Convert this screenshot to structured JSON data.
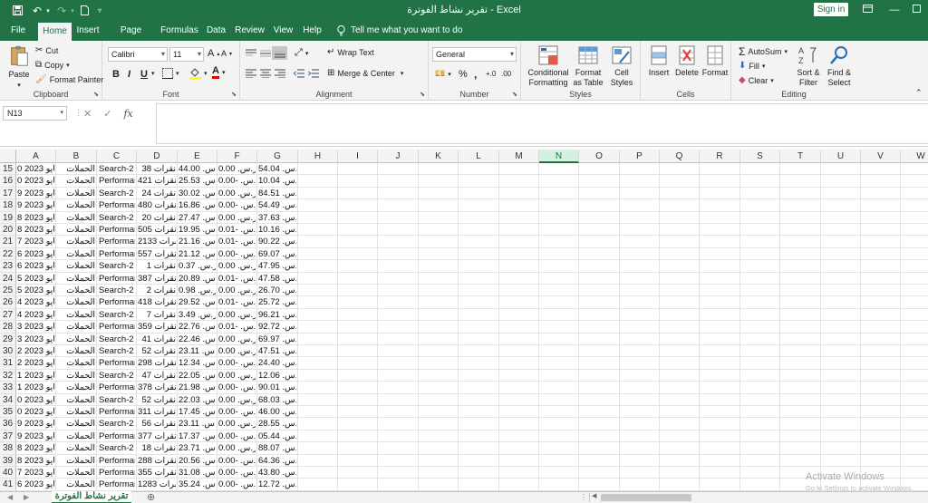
{
  "app": {
    "title": "تقرير نشاط الفوترة  -  Excel",
    "signin": "Sign in"
  },
  "tabs": [
    "File",
    "Home",
    "Insert",
    "Page Layout",
    "Formulas",
    "Data",
    "Review",
    "View",
    "Help"
  ],
  "tell_me": "Tell me what you want to do",
  "ribbon": {
    "clipboard": {
      "label": "Clipboard",
      "paste": "Paste",
      "cut": "Cut",
      "copy": "Copy",
      "format_painter": "Format Painter"
    },
    "font": {
      "label": "Font",
      "family": "Calibri",
      "size": "11",
      "bold": "B",
      "italic": "I",
      "underline": "U"
    },
    "alignment": {
      "label": "Alignment",
      "wrap": "Wrap Text",
      "merge": "Merge & Center"
    },
    "number": {
      "label": "Number",
      "format": "General",
      "percent": "%",
      "comma": ","
    },
    "styles": {
      "label": "Styles",
      "conditional": "Conditional Formatting",
      "table": "Format as Table",
      "cell_styles": "Cell Styles"
    },
    "cells": {
      "label": "Cells",
      "insert": "Insert",
      "delete": "Delete",
      "format": "Format"
    },
    "editing": {
      "label": "Editing",
      "autosum": "AutoSum",
      "fill": "Fill",
      "clear": "Clear",
      "sort": "Sort & Filter",
      "find": "Find & Select"
    }
  },
  "formula_bar": {
    "name_box": "N13",
    "fx": "fx",
    "value": ""
  },
  "columns": [
    "A",
    "B",
    "C",
    "D",
    "E",
    "F",
    "G",
    "H",
    "I",
    "J",
    "K",
    "L",
    "M",
    "N",
    "O",
    "P",
    "Q",
    "R",
    "S",
    "T",
    "U",
    "V",
    "W"
  ],
  "selected_column": "N",
  "rows": [
    {
      "n": "15",
      "a": "مايو 2023 0",
      "b": "الحملات",
      "c": "Search-2",
      "d": "38 نقرات",
      "e": "ر.س.‏ 44.00",
      "f": "ر.س.‏ 0.00",
      "g": "ر.س.‏ 54.04"
    },
    {
      "n": "16",
      "a": "مايو 2023 0",
      "b": "الحملات",
      "c": "Performan",
      "d": "421 نقرات",
      "e": "ر.س.‏ 25.53",
      "f": "ر.س.‏ -0.00",
      "g": "ر.س.‏ 10.04"
    },
    {
      "n": "17",
      "a": "مايو 2023 9",
      "b": "الحملات",
      "c": "Search-2",
      "d": "24 نقرات",
      "e": "ر.س.‏ 30.02",
      "f": "ر.س.‏ 0.00",
      "g": "ر.س.‏ 84.51"
    },
    {
      "n": "18",
      "a": "مايو 2023 9",
      "b": "الحملات",
      "c": "Performan",
      "d": "480 نقرات",
      "e": "ر.س.‏ 16.86",
      "f": "ر.س.‏ -0.00",
      "g": "ر.س.‏ 54.49"
    },
    {
      "n": "19",
      "a": "مايو 2023 8",
      "b": "الحملات",
      "c": "Search-2",
      "d": "20 نقرات",
      "e": "ر.س.‏ 27.47",
      "f": "ر.س.‏ 0.00",
      "g": "ر.س.‏ 37.63"
    },
    {
      "n": "20",
      "a": "مايو 2023 8",
      "b": "الحملات",
      "c": "Performan",
      "d": "505 نقرات",
      "e": "ر.س.‏ 19.95",
      "f": "ر.س.‏ -0.01",
      "g": "ر.س.‏ 10.16"
    },
    {
      "n": "21",
      "a": "مايو 2023 7",
      "b": "الحملات",
      "c": "Performan",
      "d": "2133 نقرات",
      "e": "ر.س.‏ 21.16",
      "f": "ر.س.‏ -0.01",
      "g": "ر.س.‏ 90.22"
    },
    {
      "n": "22",
      "a": "مايو 2023 6",
      "b": "الحملات",
      "c": "Performan",
      "d": "557 نقرات",
      "e": "ر.س.‏ 21.12",
      "f": "ر.س.‏ -0.00",
      "g": "ر.س.‏ 69.07"
    },
    {
      "n": "23",
      "a": "مايو 2023 6",
      "b": "الحملات",
      "c": "Search-2",
      "d": "1 نقرات",
      "e": "ر.س.‏ 0.37",
      "f": "ر.س.‏ 0.00",
      "g": "ر.س.‏ 47.95"
    },
    {
      "n": "24",
      "a": "مايو 2023 5",
      "b": "الحملات",
      "c": "Performan",
      "d": "387 نقرات",
      "e": "ر.س.‏ 20.89",
      "f": "ر.س.‏ -0.01",
      "g": "ر.س.‏ 47.58"
    },
    {
      "n": "25",
      "a": "مايو 2023 5",
      "b": "الحملات",
      "c": "Search-2",
      "d": "2 نقرات",
      "e": "ر.س.‏ 0.98",
      "f": "ر.س.‏ 0.00",
      "g": "ر.س.‏ 26.70"
    },
    {
      "n": "26",
      "a": "مايو 2023 4",
      "b": "الحملات",
      "c": "Performan",
      "d": "418 نقرات",
      "e": "ر.س.‏ 29.52",
      "f": "ر.س.‏ -0.01",
      "g": "ر.س.‏ 25.72"
    },
    {
      "n": "27",
      "a": "مايو 2023 4",
      "b": "الحملات",
      "c": "Search-2",
      "d": "7 نقرات",
      "e": "ر.س.‏ 3.49",
      "f": "ر.س.‏ 0.00",
      "g": "ر.س.‏ 96.21"
    },
    {
      "n": "28",
      "a": "مايو 2023 3",
      "b": "الحملات",
      "c": "Performan",
      "d": "359 نقرات",
      "e": "ر.س.‏ 22.76",
      "f": "ر.س.‏ -0.01",
      "g": "ر.س.‏ 92.72"
    },
    {
      "n": "29",
      "a": "مايو 2023 3",
      "b": "الحملات",
      "c": "Search-2",
      "d": "41 نقرات",
      "e": "ر.س.‏ 22.46",
      "f": "ر.س.‏ 0.00",
      "g": "ر.س.‏ 69.97"
    },
    {
      "n": "30",
      "a": "مايو 2023 2",
      "b": "الحملات",
      "c": "Search-2",
      "d": "52 نقرات",
      "e": "ر.س.‏ 23.11",
      "f": "ر.س.‏ 0.00",
      "g": "ر.س.‏ 47.51"
    },
    {
      "n": "31",
      "a": "مايو 2023 2",
      "b": "الحملات",
      "c": "Performan",
      "d": "298 نقرات",
      "e": "ر.س.‏ 12.34",
      "f": "ر.س.‏ -0.00",
      "g": "ر.س.‏ 24.40"
    },
    {
      "n": "32",
      "a": "مايو 2023 1",
      "b": "الحملات",
      "c": "Search-2",
      "d": "47 نقرات",
      "e": "ر.س.‏ 22.05",
      "f": "ر.س.‏ 0.00",
      "g": "ر.س.‏ 12.06"
    },
    {
      "n": "33",
      "a": "مايو 2023 1",
      "b": "الحملات",
      "c": "Performan",
      "d": "378 نقرات",
      "e": "ر.س.‏ 21.98",
      "f": "ر.س.‏ -0.00",
      "g": "ر.س.‏ 90.01"
    },
    {
      "n": "34",
      "a": "مايو 2023 0",
      "b": "الحملات",
      "c": "Search-2",
      "d": "52 نقرات",
      "e": "ر.س.‏ 22.03",
      "f": "ر.س.‏ 0.00",
      "g": "ر.س.‏ 68.03"
    },
    {
      "n": "35",
      "a": "مايو 2023 0",
      "b": "الحملات",
      "c": "Performan",
      "d": "311 نقرات",
      "e": "ر.س.‏ 17.45",
      "f": "ر.س.‏ -0.00",
      "g": "ر.س.‏ 46.00"
    },
    {
      "n": "36",
      "a": "مايو 2023 9",
      "b": "الحملات",
      "c": "Search-2",
      "d": "56 نقرات",
      "e": "ر.س.‏ 23.11",
      "f": "ر.س.‏ 0.00",
      "g": "ر.س.‏ 28.55"
    },
    {
      "n": "37",
      "a": "مايو 2023 9",
      "b": "الحملات",
      "c": "Performan",
      "d": "377 نقرات",
      "e": "ر.س.‏ 17.37",
      "f": "ر.س.‏ -0.00",
      "g": "ر.س.‏ 05.44"
    },
    {
      "n": "38",
      "a": "مايو 2023 8",
      "b": "الحملات",
      "c": "Search-2",
      "d": "18 نقرات",
      "e": "ر.س.‏ 23.71",
      "f": "ر.س.‏ 0.00",
      "g": "ر.س.‏ 88.07"
    },
    {
      "n": "39",
      "a": "مايو 2023 8",
      "b": "الحملات",
      "c": "Performan",
      "d": "288 نقرات",
      "e": "ر.س.‏ 20.56",
      "f": "ر.س.‏ -0.00",
      "g": "ر.س.‏ 64.36"
    },
    {
      "n": "40",
      "a": "مايو 2023 7",
      "b": "الحملات",
      "c": "Performan",
      "d": "355 نقرات",
      "e": "ر.س.‏ 31.08",
      "f": "ر.س.‏ -0.00",
      "g": "ر.س.‏ 43.80"
    },
    {
      "n": "41",
      "a": "مايو 2023 6",
      "b": "الحملات",
      "c": "Performan",
      "d": "1283 نقرات",
      "e": "ر.س.‏ 35.24",
      "f": "ر.س.‏ -0.00",
      "g": "ر.س.‏ 12.72"
    }
  ],
  "sheet_tab": "تقرير نشاط الفوترة",
  "watermark": {
    "line1": "Activate Windows",
    "line2": "Go to Settings to activate Windows."
  },
  "colors": {
    "excel_green": "#217346",
    "ribbon_bg": "#f3f3f3"
  }
}
